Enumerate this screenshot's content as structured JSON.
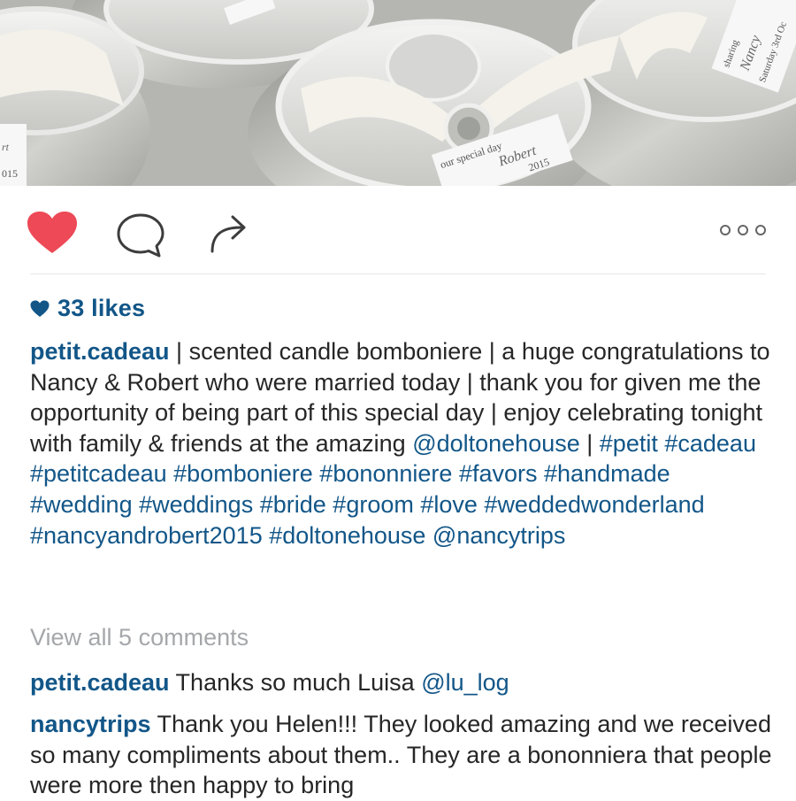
{
  "photo": {
    "tag_lines": [
      "sharing",
      "our special day",
      "Nancy",
      "Robert",
      "Saturday 3rd Oc",
      "2015",
      "rt",
      "015"
    ]
  },
  "actions": {
    "like_icon": "heart-filled-icon",
    "comment_icon": "comment-bubble-icon",
    "share_icon": "share-arrow-icon",
    "more_icon": "more-dots-icon",
    "like_color": "#ed4956"
  },
  "likes": {
    "icon": "small-heart-icon",
    "label": "33 likes"
  },
  "caption": {
    "username": "petit.cadeau",
    "text_1": " | scented candle bomboniere | a huge congratulations to Nancy & Robert who were married today | thank you for given me the opportunity of being part of this special day | enjoy celebrating tonight with family & friends at the amazing ",
    "mention_1": "@doltonehouse",
    "text_2": " | ",
    "tags": [
      "#petit",
      "#cadeau",
      "#petitcadeau",
      "#bomboniere",
      "#bononniere",
      "#favors",
      "#handmade",
      "#wedding",
      "#weddings",
      "#bride",
      "#groom",
      "#love",
      "#weddedwonderland",
      "#nancyandrobert2015",
      "#doltonehouse"
    ],
    "mention_2": "@nancytrips"
  },
  "view_all": "View all 5 comments",
  "comments": [
    {
      "username": "petit.cadeau",
      "text": " Thanks so much Luisa ",
      "mention": "@lu_log"
    },
    {
      "username": "nancytrips",
      "text": " Thank you Helen!!! They looked amazing and we received so many compliments about them.. They are a bononniera that people were more then happy to bring"
    }
  ],
  "colors": {
    "link": "#125688",
    "text": "#262626",
    "muted": "#a5a7aa"
  }
}
